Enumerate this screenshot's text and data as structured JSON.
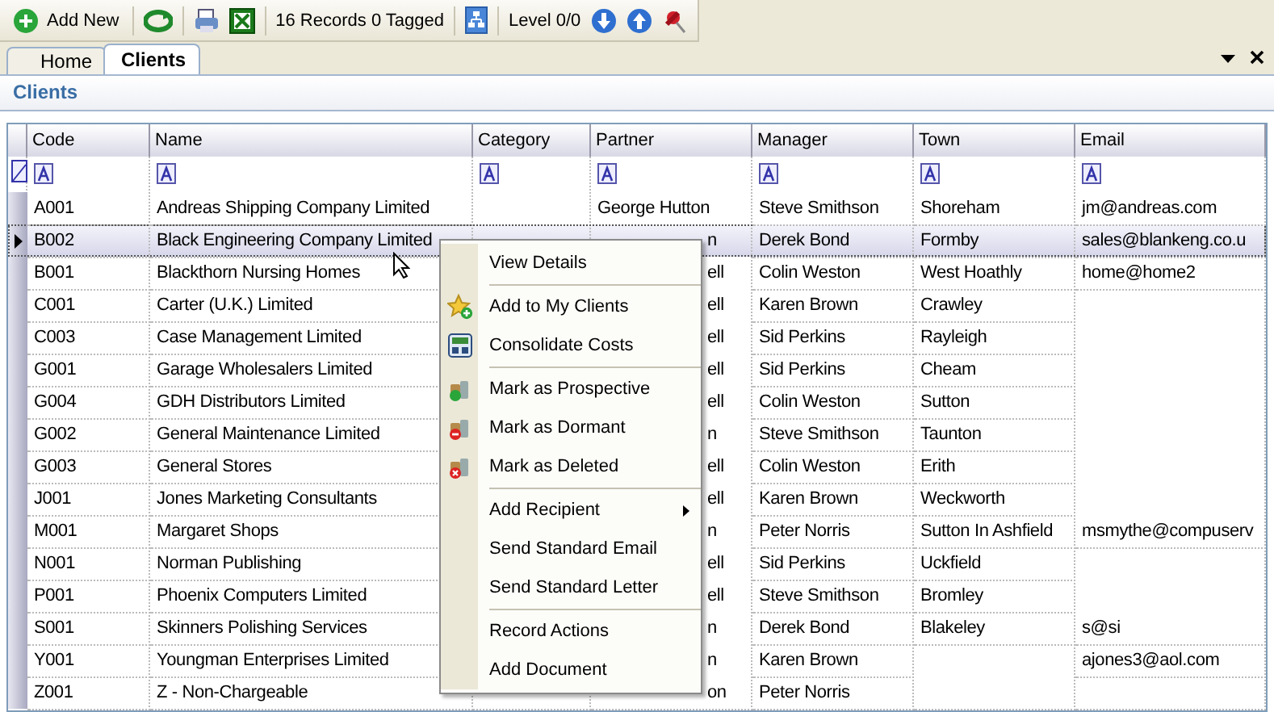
{
  "toolbar": {
    "add_label": "Add New",
    "records": "16 Records 0 Tagged",
    "level": "Level 0/0"
  },
  "tabs": [
    {
      "label": "Home",
      "selected": false
    },
    {
      "label": "Clients",
      "selected": true
    }
  ],
  "panel_title": "Clients",
  "table": {
    "columns": [
      "Code",
      "Name",
      "Category",
      "Partner",
      "Manager",
      "Town",
      "Email"
    ],
    "rows": [
      {
        "code": "A001",
        "name": "Andreas Shipping Company Limited",
        "partner": {
          "text": "George Hutton",
          "clipped": false
        },
        "manager": "Steve Smithson",
        "town": "Shoreham",
        "email": "jm@andreas.com",
        "selected": false
      },
      {
        "code": "B002",
        "name": "Black Engineering Company Limited",
        "partner": {
          "text": "n",
          "clipped": true
        },
        "manager": "Derek Bond",
        "town": "Formby",
        "email": "sales@blankeng.co.u",
        "selected": true
      },
      {
        "code": "B001",
        "name": "Blackthorn Nursing Homes",
        "partner": {
          "text": "ell",
          "clipped": true
        },
        "manager": "Colin Weston",
        "town": "West Hoathly",
        "email": "home@home2",
        "selected": false
      },
      {
        "code": "C001",
        "name": "Carter (U.K.) Limited",
        "partner": {
          "text": "ell",
          "clipped": true
        },
        "manager": "Karen Brown",
        "town": "Crawley",
        "selected": false
      },
      {
        "code": "C003",
        "name": "Case Management Limited",
        "partner": {
          "text": "ell",
          "clipped": true
        },
        "manager": "Sid Perkins",
        "town": "Rayleigh",
        "selected": false
      },
      {
        "code": "G001",
        "name": "Garage Wholesalers Limited",
        "partner": {
          "text": "ell",
          "clipped": true
        },
        "manager": "Sid Perkins",
        "town": "Cheam",
        "selected": false
      },
      {
        "code": "G004",
        "name": "GDH Distributors Limited",
        "partner": {
          "text": "ell",
          "clipped": true
        },
        "manager": "Colin Weston",
        "town": "Sutton",
        "selected": false
      },
      {
        "code": "G002",
        "name": "General Maintenance Limited",
        "partner": {
          "text": "n",
          "clipped": true
        },
        "manager": "Steve Smithson",
        "town": "Taunton",
        "selected": false
      },
      {
        "code": "G003",
        "name": "General Stores",
        "partner": {
          "text": "ell",
          "clipped": true
        },
        "manager": "Colin Weston",
        "town": "Erith",
        "selected": false
      },
      {
        "code": "J001",
        "name": "Jones Marketing Consultants",
        "partner": {
          "text": "ell",
          "clipped": true
        },
        "manager": "Karen Brown",
        "town": "Weckworth",
        "selected": false
      },
      {
        "code": "M001",
        "name": "Margaret Shops",
        "partner": {
          "text": "n",
          "clipped": true
        },
        "manager": "Peter Norris",
        "town": "Sutton In Ashfield",
        "email": "msmythe@compuserv",
        "selected": false
      },
      {
        "code": "N001",
        "name": "Norman Publishing",
        "partner": {
          "text": "ell",
          "clipped": true
        },
        "manager": "Sid Perkins",
        "town": "Uckfield",
        "selected": false
      },
      {
        "code": "P001",
        "name": "Phoenix Computers Limited",
        "partner": {
          "text": "ell",
          "clipped": true
        },
        "manager": "Steve Smithson",
        "town": "Bromley",
        "selected": false
      },
      {
        "code": "S001",
        "name": "Skinners Polishing Services",
        "partner": {
          "text": "n",
          "clipped": true
        },
        "manager": "Derek Bond",
        "town": "Blakeley",
        "email": "s@si",
        "selected": false
      },
      {
        "code": "Y001",
        "name": "Youngman Enterprises Limited",
        "partner": {
          "text": "n",
          "clipped": true
        },
        "manager": "Karen Brown",
        "email": "ajones3@aol.com",
        "selected": false
      },
      {
        "code": "Z001",
        "name": "Z - Non-Chargeable",
        "partner": {
          "text": "on",
          "clipped": true
        },
        "manager": "Peter Norris",
        "selected": false
      }
    ]
  },
  "context_menu": [
    {
      "kind": "item",
      "label": "View Details"
    },
    {
      "kind": "separator"
    },
    {
      "kind": "item",
      "label": "Add to My Clients"
    },
    {
      "kind": "item",
      "label": "Consolidate Costs"
    },
    {
      "kind": "separator"
    },
    {
      "kind": "item",
      "label": "Mark as Prospective"
    },
    {
      "kind": "item",
      "label": "Mark as Dormant"
    },
    {
      "kind": "item",
      "label": "Mark as Deleted"
    },
    {
      "kind": "separator"
    },
    {
      "kind": "item",
      "label": "Add Recipient",
      "submenu": true
    },
    {
      "kind": "item",
      "label": "Send Standard Email"
    },
    {
      "kind": "item",
      "label": "Send Standard Letter"
    },
    {
      "kind": "separator"
    },
    {
      "kind": "item",
      "label": "Record Actions"
    },
    {
      "kind": "item",
      "label": "Add Document"
    }
  ]
}
